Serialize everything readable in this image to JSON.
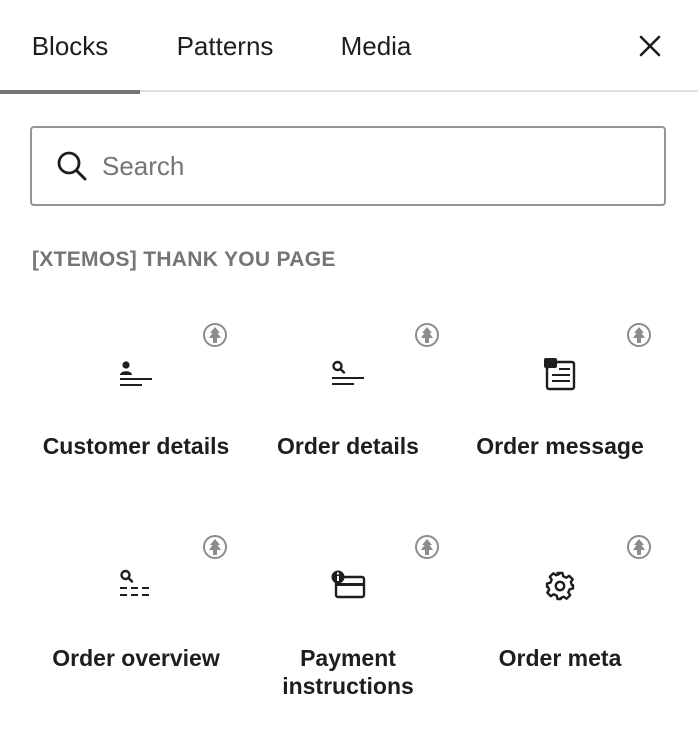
{
  "tabs": [
    {
      "label": "Blocks",
      "active": true
    },
    {
      "label": "Patterns",
      "active": false
    },
    {
      "label": "Media",
      "active": false
    }
  ],
  "close_icon": "close-icon",
  "search": {
    "placeholder": "Search",
    "value": "",
    "icon": "search-icon"
  },
  "category": {
    "title": "[XTEMOS] THANK YOU PAGE"
  },
  "blocks": [
    {
      "label": "Customer details",
      "icon": "customer-details-icon"
    },
    {
      "label": "Order details",
      "icon": "order-details-icon"
    },
    {
      "label": "Order message",
      "icon": "order-message-icon"
    },
    {
      "label": "Order overview",
      "icon": "order-overview-icon"
    },
    {
      "label": "Payment instructions",
      "icon": "payment-instructions-icon"
    },
    {
      "label": "Order meta",
      "icon": "gear-icon"
    }
  ],
  "colors": {
    "text": "#1e1e1e",
    "muted": "#757575",
    "border": "#949494",
    "pro_badge": "#8c8c8c"
  }
}
